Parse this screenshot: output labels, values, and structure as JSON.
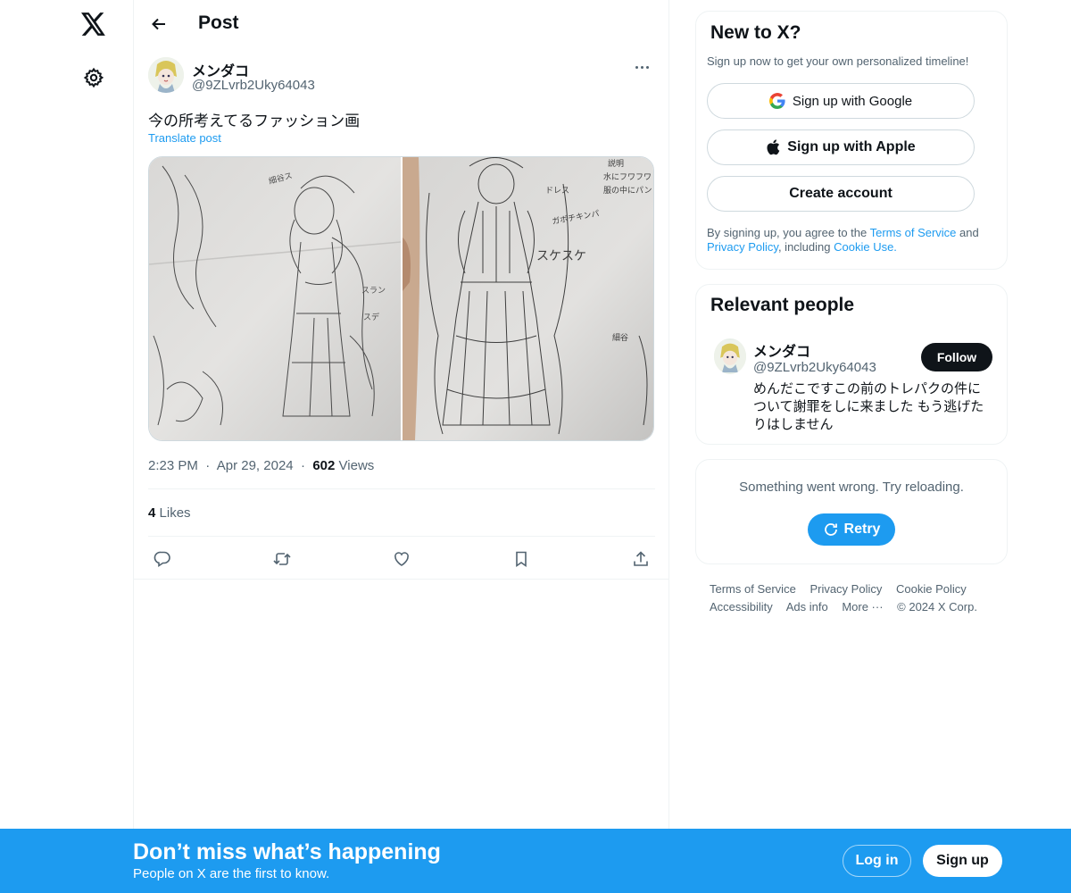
{
  "header": {
    "title": "Post"
  },
  "post": {
    "author_name": "メンダコ",
    "author_handle": "@9ZLvrb2Uky64043",
    "text": "今の所考えてるファッション画",
    "translate_label": "Translate post",
    "time": "2:23 PM",
    "date": "Apr 29, 2024",
    "views_count": "602",
    "views_label": "Views",
    "likes_count": "4",
    "likes_label": "Likes",
    "separator": "·"
  },
  "signup_card": {
    "title": "New to X?",
    "subtitle": "Sign up now to get your own personalized timeline!",
    "google_label": "Sign up with Google",
    "apple_label": "Sign up with Apple",
    "create_label": "Create account",
    "terms_prefix": "By signing up, you agree to the ",
    "terms_link": "Terms of Service",
    "terms_and": " and ",
    "privacy_link": "Privacy Policy",
    "terms_including": ", including ",
    "cookie_link": "Cookie Use."
  },
  "relevant_people": {
    "title": "Relevant people",
    "name": "メンダコ",
    "handle": "@9ZLvrb2Uky64043",
    "follow_label": "Follow",
    "bio": "めんだこですこの前のトレパクの件について謝罪をしに来ました もう逃げたりはしません"
  },
  "error_card": {
    "message": "Something went wrong. Try reloading.",
    "retry_label": "Retry"
  },
  "footer": {
    "terms": "Terms of Service",
    "privacy": "Privacy Policy",
    "cookie": "Cookie Policy",
    "accessibility": "Accessibility",
    "ads": "Ads info",
    "more": "More ···",
    "copyright": "© 2024 X Corp."
  },
  "bottom_bar": {
    "title": "Don’t miss what’s happening",
    "subtitle": "People on X are the first to know.",
    "login_label": "Log in",
    "signup_label": "Sign up"
  },
  "colors": {
    "accent": "#1d9bf0",
    "text": "#0f1419",
    "muted": "#536471"
  },
  "icons": [
    "x-logo-icon",
    "gear-icon",
    "arrow-left-icon",
    "more-icon",
    "reply-icon",
    "repost-icon",
    "like-icon",
    "bookmark-icon",
    "share-icon",
    "google-icon",
    "apple-icon",
    "refresh-icon"
  ]
}
